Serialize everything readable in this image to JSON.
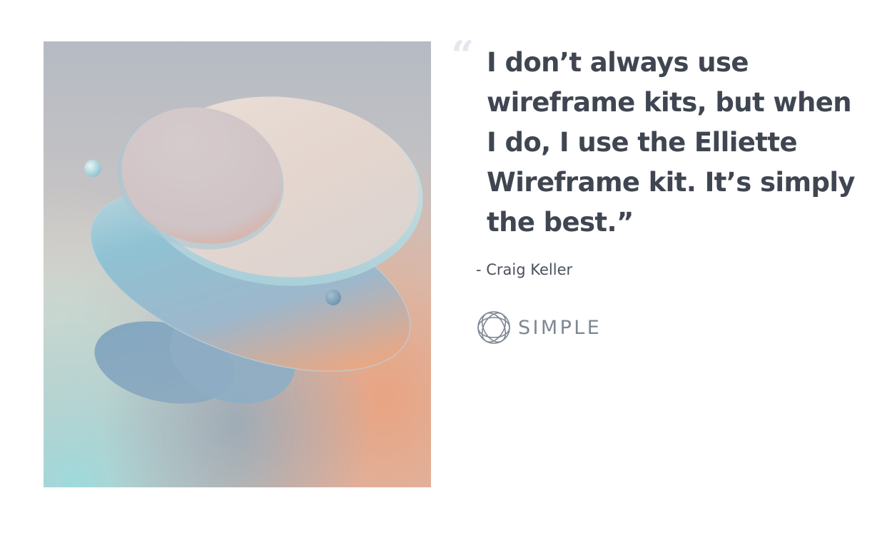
{
  "testimonial": {
    "quote_mark": "“",
    "quote": "I don’t always use wireframe kits, but when I do, I use the Elliette Wireframe kit. It’s simply the best.”",
    "author": "- Craig Keller"
  },
  "brand": {
    "name": "SIMPLE",
    "logo_icon": "interlaced-rings-logo-icon"
  },
  "hero_image": {
    "subject": "abstract-floating-discs-illustration"
  },
  "colors": {
    "heading": "#3f4651",
    "quote_mark": "#e4e8ee",
    "brand_gray": "#7e8793",
    "art_peach": "#eaa583",
    "art_teal": "#9fd9dc"
  }
}
